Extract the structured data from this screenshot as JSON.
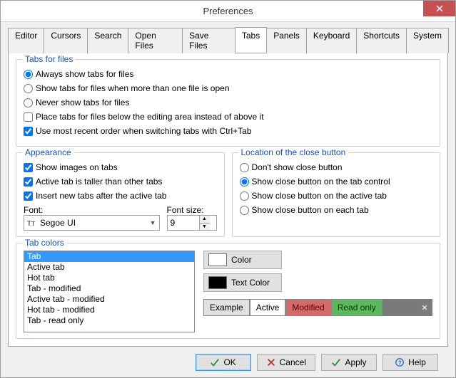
{
  "window": {
    "title": "Preferences"
  },
  "tabs": [
    "Editor",
    "Cursors",
    "Search",
    "Open Files",
    "Save Files",
    "Tabs",
    "Panels",
    "Keyboard",
    "Shortcuts",
    "System"
  ],
  "activeTab": "Tabs",
  "tabsForFiles": {
    "legend": "Tabs for files",
    "r0": "Always show tabs for files",
    "r1": "Show tabs for files when more than one file is open",
    "r2": "Never show tabs for files",
    "c0": "Place tabs for files below the editing area instead of above it",
    "c1": "Use most recent order when switching tabs with Ctrl+Tab"
  },
  "appearance": {
    "legend": "Appearance",
    "c0": "Show images on tabs",
    "c1": "Active tab is taller than other tabs",
    "c2": "Insert new tabs after the active tab",
    "fontLabel": "Font:",
    "fontValue": "Segoe UI",
    "fontSizeLabel": "Font size:",
    "fontSizeValue": "9"
  },
  "closeLoc": {
    "legend": "Location of the close button",
    "r0": "Don't show close button",
    "r1": "Show close button on the tab control",
    "r2": "Show close button on the active tab",
    "r3": "Show close button on each tab"
  },
  "tabColors": {
    "legend": "Tab colors",
    "items": [
      "Tab",
      "Active tab",
      "Hot tab",
      "Tab - modified",
      "Active tab - modified",
      "Hot tab - modified",
      "Tab - read only"
    ],
    "colorBtn": "Color",
    "textColorBtn": "Text Color",
    "example": [
      "Example",
      "Active",
      "Modified",
      "Read only"
    ]
  },
  "buttons": {
    "ok": "OK",
    "cancel": "Cancel",
    "apply": "Apply",
    "help": "Help"
  }
}
